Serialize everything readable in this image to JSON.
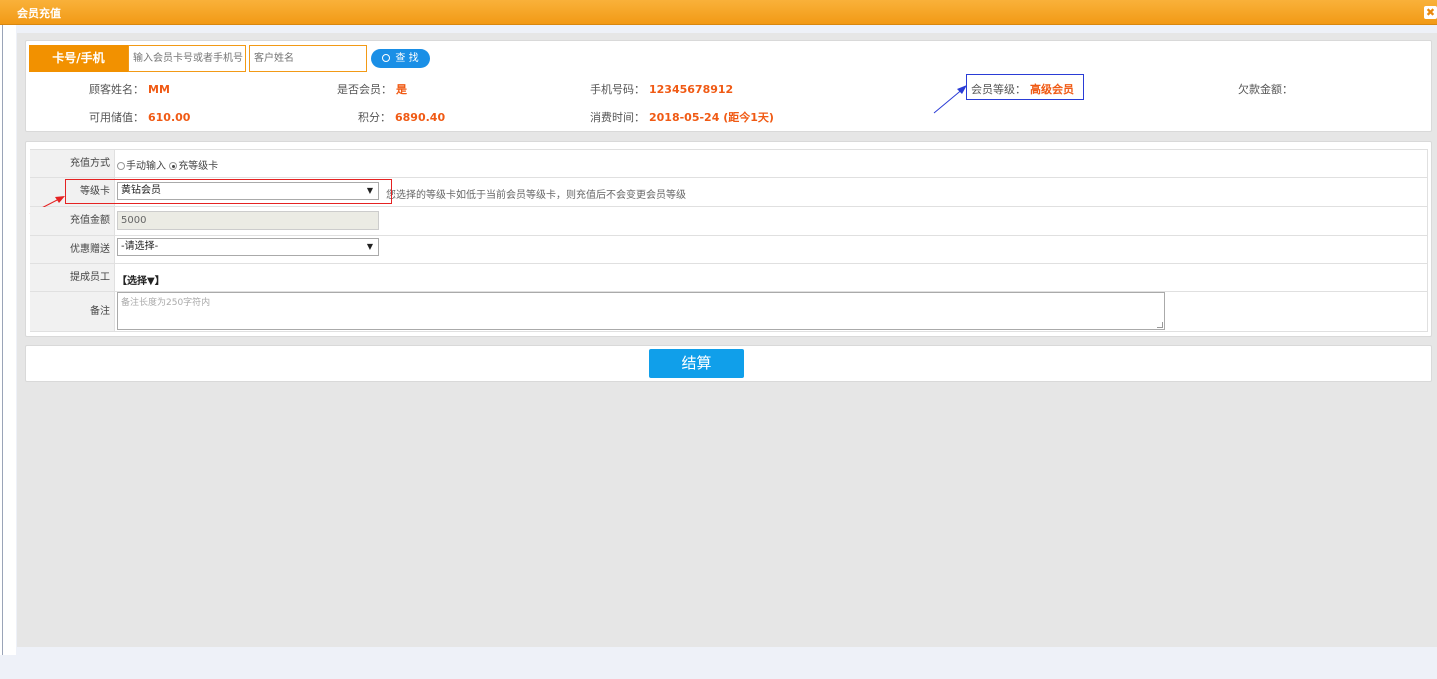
{
  "window": {
    "title": "会员充值",
    "close_glyph": "✖"
  },
  "search": {
    "card_label": "卡号/手机",
    "card_placeholder": "输入会员卡号或者手机号",
    "name_placeholder": "客户姓名",
    "search_button": "查 找"
  },
  "member": {
    "name_label": "顾客姓名：",
    "name_value": "MM",
    "is_member_label": "是否会员：",
    "is_member_value": "是",
    "phone_label": "手机号码：",
    "phone_value": "12345678912",
    "level_label": "会员等级：",
    "level_value": "高级会员",
    "debt_label": "欠款金额：",
    "balance_label": "可用储值：",
    "balance_value": "610.00",
    "points_label": "积分：",
    "points_value": "6890.40",
    "time_label": "消费时间：",
    "time_value": "2018-05-24 (距今1天)"
  },
  "form": {
    "method_label": "充值方式",
    "method_option1": "手动输入",
    "method_option2": "充等级卡",
    "level_card_label": "等级卡",
    "level_card_value": "黄钻会员",
    "level_card_hint": "您选择的等级卡如低于当前会员等级卡，则充值后不会变更会员等级",
    "amount_label": "充值金额",
    "amount_value": "5000",
    "promo_label": "优惠赠送",
    "promo_value": "-请选择-",
    "staff_label": "提成员工",
    "staff_value": "【选择▼】",
    "remark_label": "备注",
    "remark_placeholder": "备注长度为250字符内",
    "dropdown_arrow": "▼"
  },
  "actions": {
    "submit": "结算"
  },
  "colors": {
    "accent": "#f29100",
    "value": "#f05a14",
    "button": "#109fea"
  }
}
